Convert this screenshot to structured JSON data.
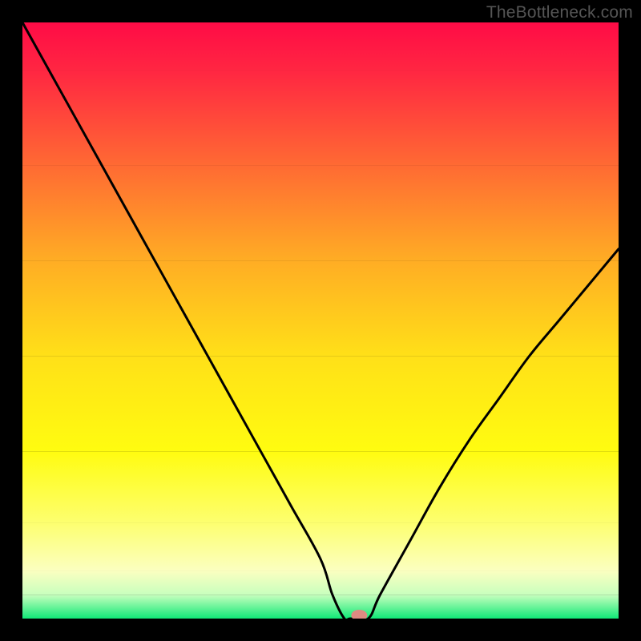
{
  "watermark": "TheBottleneck.com",
  "chart_data": {
    "type": "line",
    "title": "",
    "xlabel": "",
    "ylabel": "",
    "xlim": [
      0,
      100
    ],
    "ylim": [
      0,
      100
    ],
    "x": [
      0,
      5,
      10,
      15,
      20,
      25,
      30,
      35,
      40,
      45,
      50,
      52,
      54,
      55,
      58,
      60,
      65,
      70,
      75,
      80,
      85,
      90,
      95,
      100
    ],
    "y": [
      100,
      91,
      82,
      73,
      64,
      55,
      46,
      37,
      28,
      19,
      10,
      4,
      0,
      0,
      0,
      4,
      13,
      22,
      30,
      37,
      44,
      50,
      56,
      62
    ],
    "marker": {
      "x": 56.5,
      "y": 0,
      "color": "#dd8a82"
    },
    "background_bands": [
      {
        "y_from": 100,
        "y_to": 92,
        "color_top": "#ff0b46",
        "color_bot": "#ff2642"
      },
      {
        "y_from": 92,
        "y_to": 76,
        "color_top": "#ff2642",
        "color_bot": "#ff6a33"
      },
      {
        "y_from": 76,
        "y_to": 60,
        "color_top": "#ff6a33",
        "color_bot": "#ffad24"
      },
      {
        "y_from": 60,
        "y_to": 44,
        "color_top": "#ffad24",
        "color_bot": "#ffe018"
      },
      {
        "y_from": 44,
        "y_to": 28,
        "color_top": "#ffe018",
        "color_bot": "#fffc10"
      },
      {
        "y_from": 28,
        "y_to": 16,
        "color_top": "#fffc10",
        "color_bot": "#fdff70"
      },
      {
        "y_from": 16,
        "y_to": 8,
        "color_top": "#fdff70",
        "color_bot": "#fbffc0"
      },
      {
        "y_from": 8,
        "y_to": 4,
        "color_top": "#fbffc0",
        "color_bot": "#c8ffbe"
      },
      {
        "y_from": 4,
        "y_to": 0,
        "color_top": "#c8ffbe",
        "color_bot": "#10e977"
      }
    ]
  }
}
